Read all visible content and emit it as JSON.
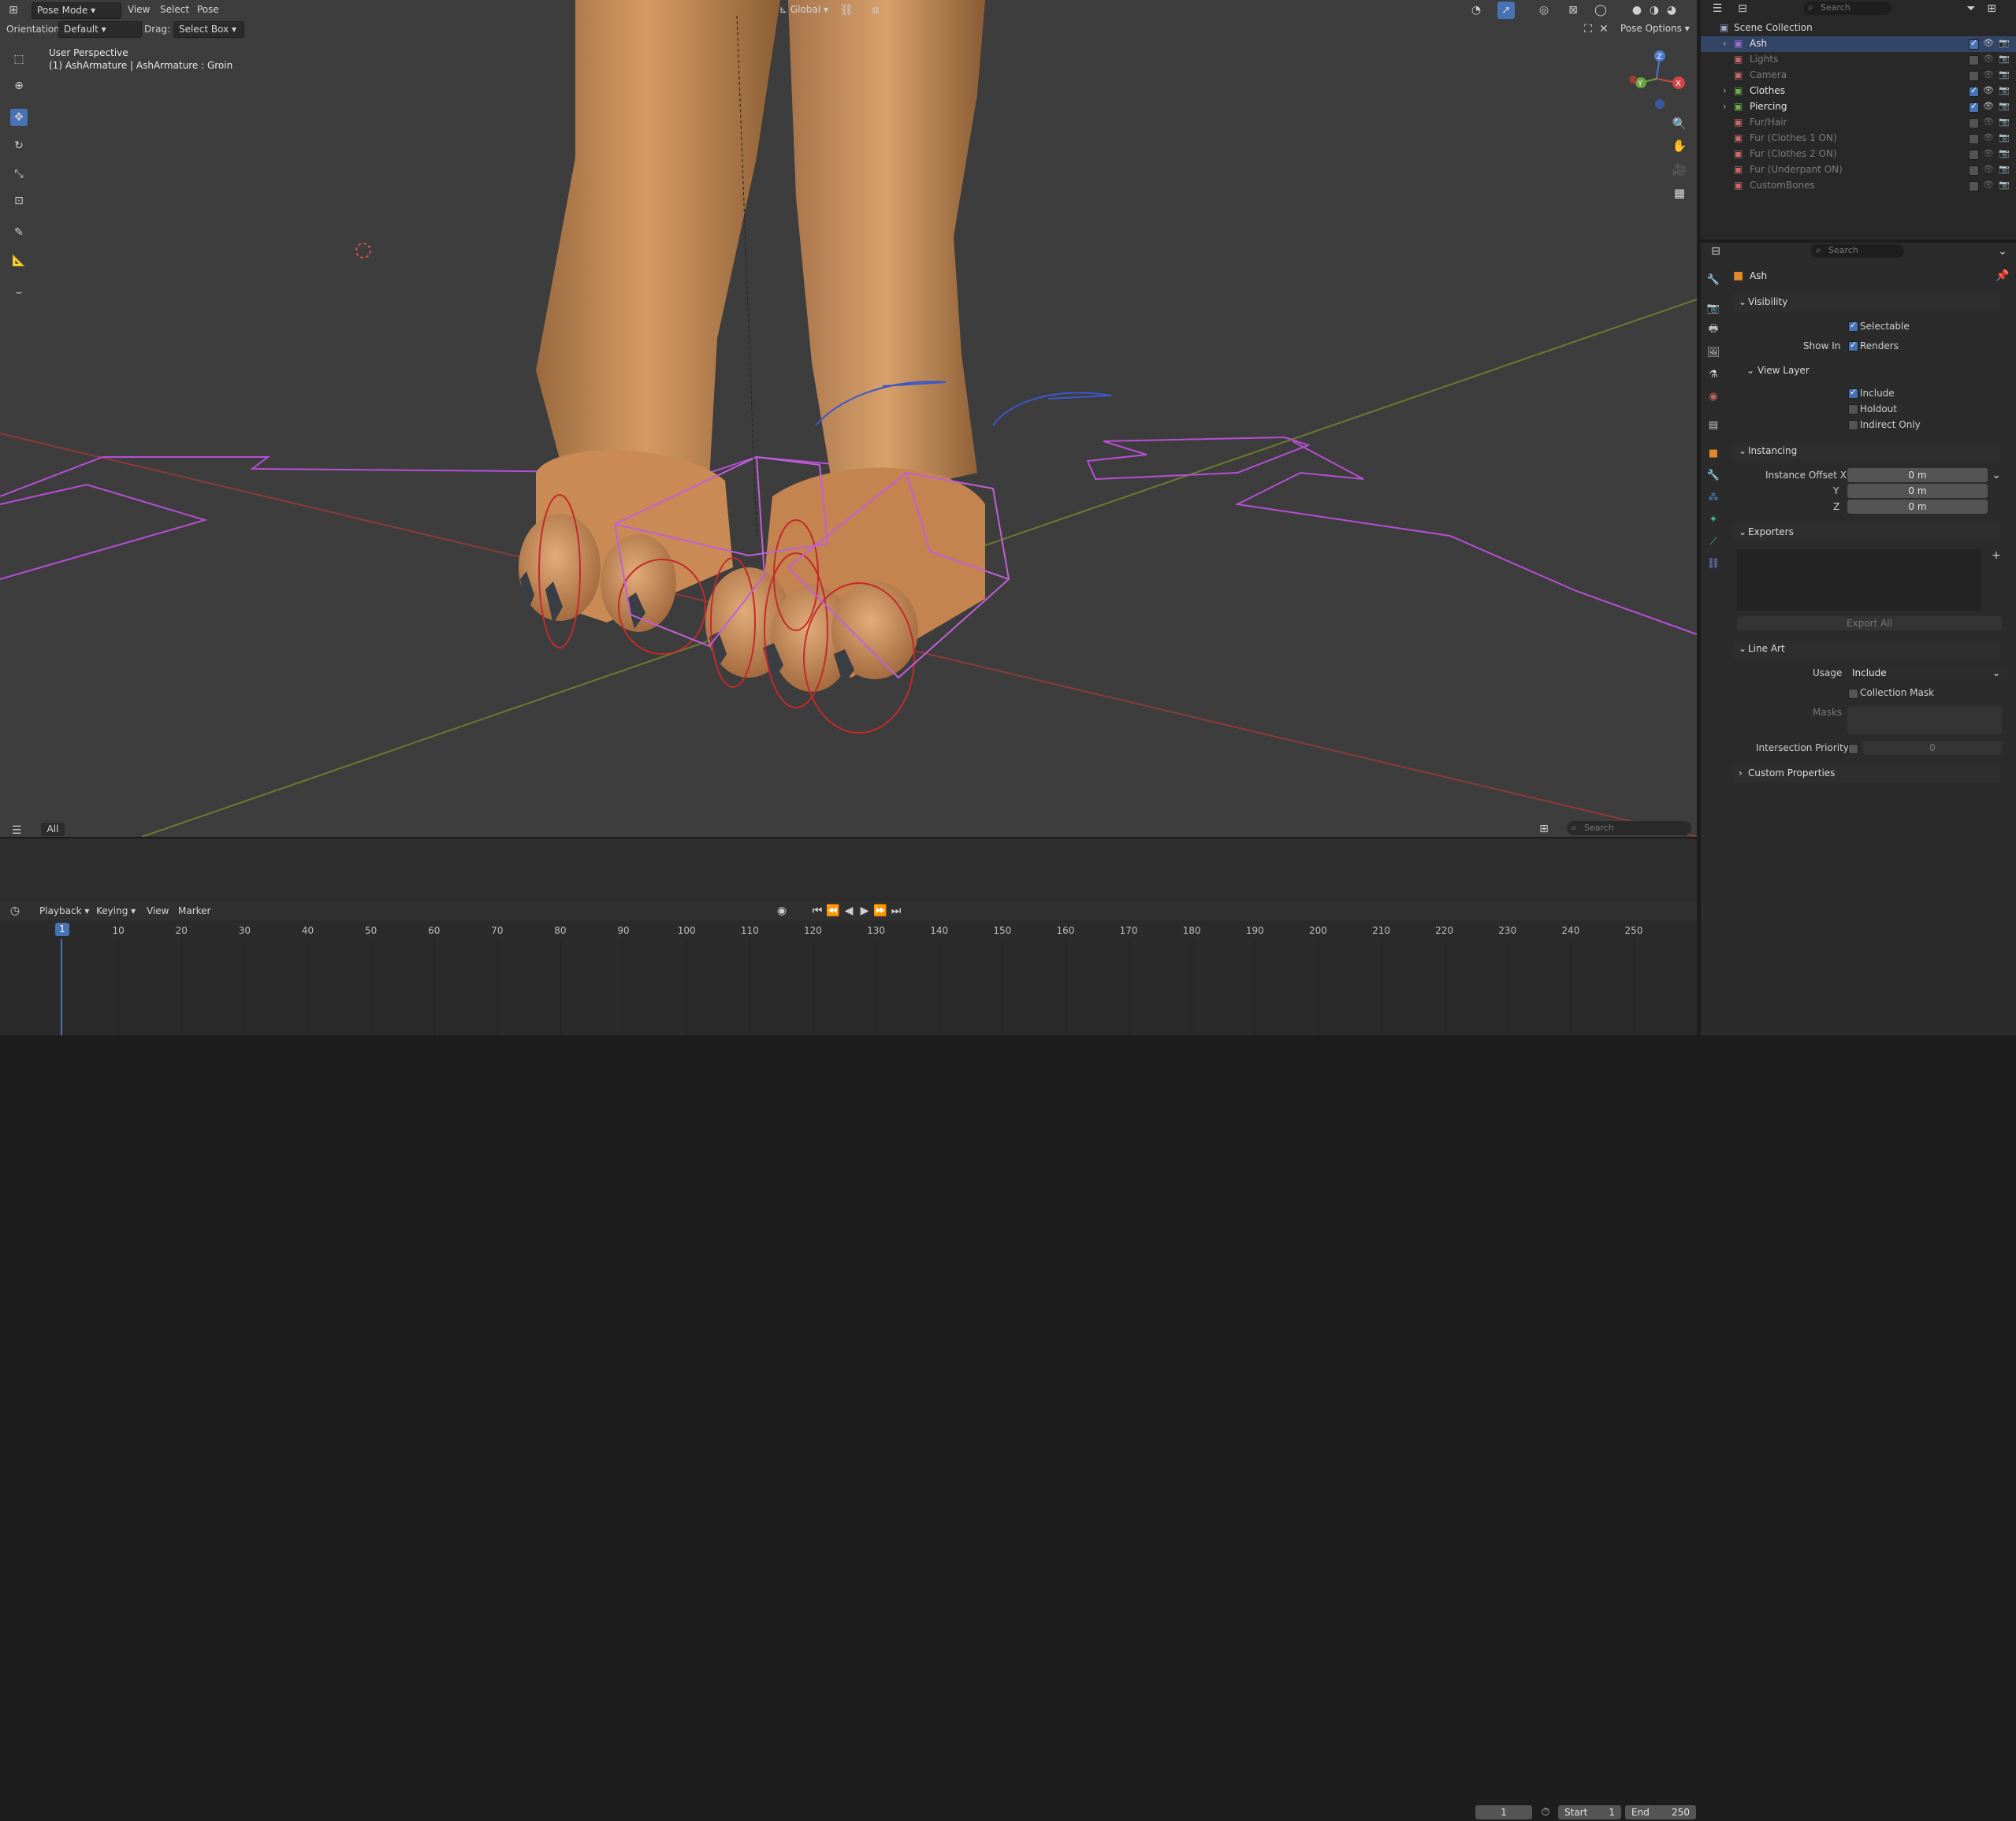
{
  "header": {
    "mode": "Pose Mode",
    "menus": [
      "View",
      "Select",
      "Pose"
    ],
    "orientation_label": "Orientation:",
    "orientation_value": "Default",
    "drag_label": "Drag:",
    "drag_value": "Select Box",
    "transform_orientation": "Global",
    "pose_options": "Pose Options",
    "search_placeholder": "Search"
  },
  "viewport": {
    "view_name": "User Perspective",
    "object_info": "(1) AshArmature | AshArmature : Groin",
    "axis_x": "X",
    "axis_y": "Y",
    "axis_z": "Z"
  },
  "bottom_bar": {
    "filter_all": "All",
    "search_placeholder": "Search"
  },
  "timeline": {
    "menus": [
      "Playback",
      "Keying",
      "View",
      "Marker"
    ],
    "current_frame": "1",
    "start_label": "Start",
    "start_value": "1",
    "end_label": "End",
    "end_value": "250",
    "ruler": [
      "1",
      "10",
      "20",
      "30",
      "40",
      "50",
      "60",
      "70",
      "80",
      "90",
      "100",
      "110",
      "120",
      "130",
      "140",
      "150",
      "160",
      "170",
      "180",
      "190",
      "200",
      "210",
      "220",
      "230",
      "240",
      "250"
    ]
  },
  "outliner": {
    "search_placeholder": "Search",
    "root": "Scene Collection",
    "items": [
      {
        "name": "Ash",
        "active": true
      },
      {
        "name": "Lights",
        "active": false
      },
      {
        "name": "Camera",
        "active": false
      },
      {
        "name": "Clothes",
        "active": true
      },
      {
        "name": "Piercing",
        "active": true
      },
      {
        "name": "Fur/Hair",
        "active": false
      },
      {
        "name": "Fur (Clothes 1 ON)",
        "active": false
      },
      {
        "name": "Fur (Clothes 2 ON)",
        "active": false
      },
      {
        "name": "Fur (Underpant ON)",
        "active": false
      },
      {
        "name": "CustomBones",
        "active": false
      }
    ]
  },
  "properties": {
    "search_placeholder": "Search",
    "object_name": "Ash",
    "visibility": {
      "title": "Visibility",
      "selectable": "Selectable",
      "show_in": "Show In",
      "renders": "Renders"
    },
    "view_layer": {
      "title": "View Layer",
      "include": "Include",
      "holdout": "Holdout",
      "indirect_only": "Indirect Only"
    },
    "instancing": {
      "title": "Instancing",
      "offset_x_label": "Instance Offset X",
      "y_label": "Y",
      "z_label": "Z",
      "x_value": "0 m",
      "y_value": "0 m",
      "z_value": "0 m"
    },
    "exporters": {
      "title": "Exporters",
      "export_all": "Export All"
    },
    "line_art": {
      "title": "Line Art",
      "usage_label": "Usage",
      "usage_value": "Include",
      "collection_mask": "Collection Mask",
      "masks": "Masks",
      "intersection_priority": "Intersection Priority",
      "priority_value": "0"
    },
    "custom_properties": "Custom Properties"
  },
  "colors": {
    "accent": "#4772b3",
    "bone_magenta": "#b64fd6",
    "bone_red": "#c42a2a",
    "bone_blue": "#3c58c8",
    "skin": "#c98a56"
  }
}
